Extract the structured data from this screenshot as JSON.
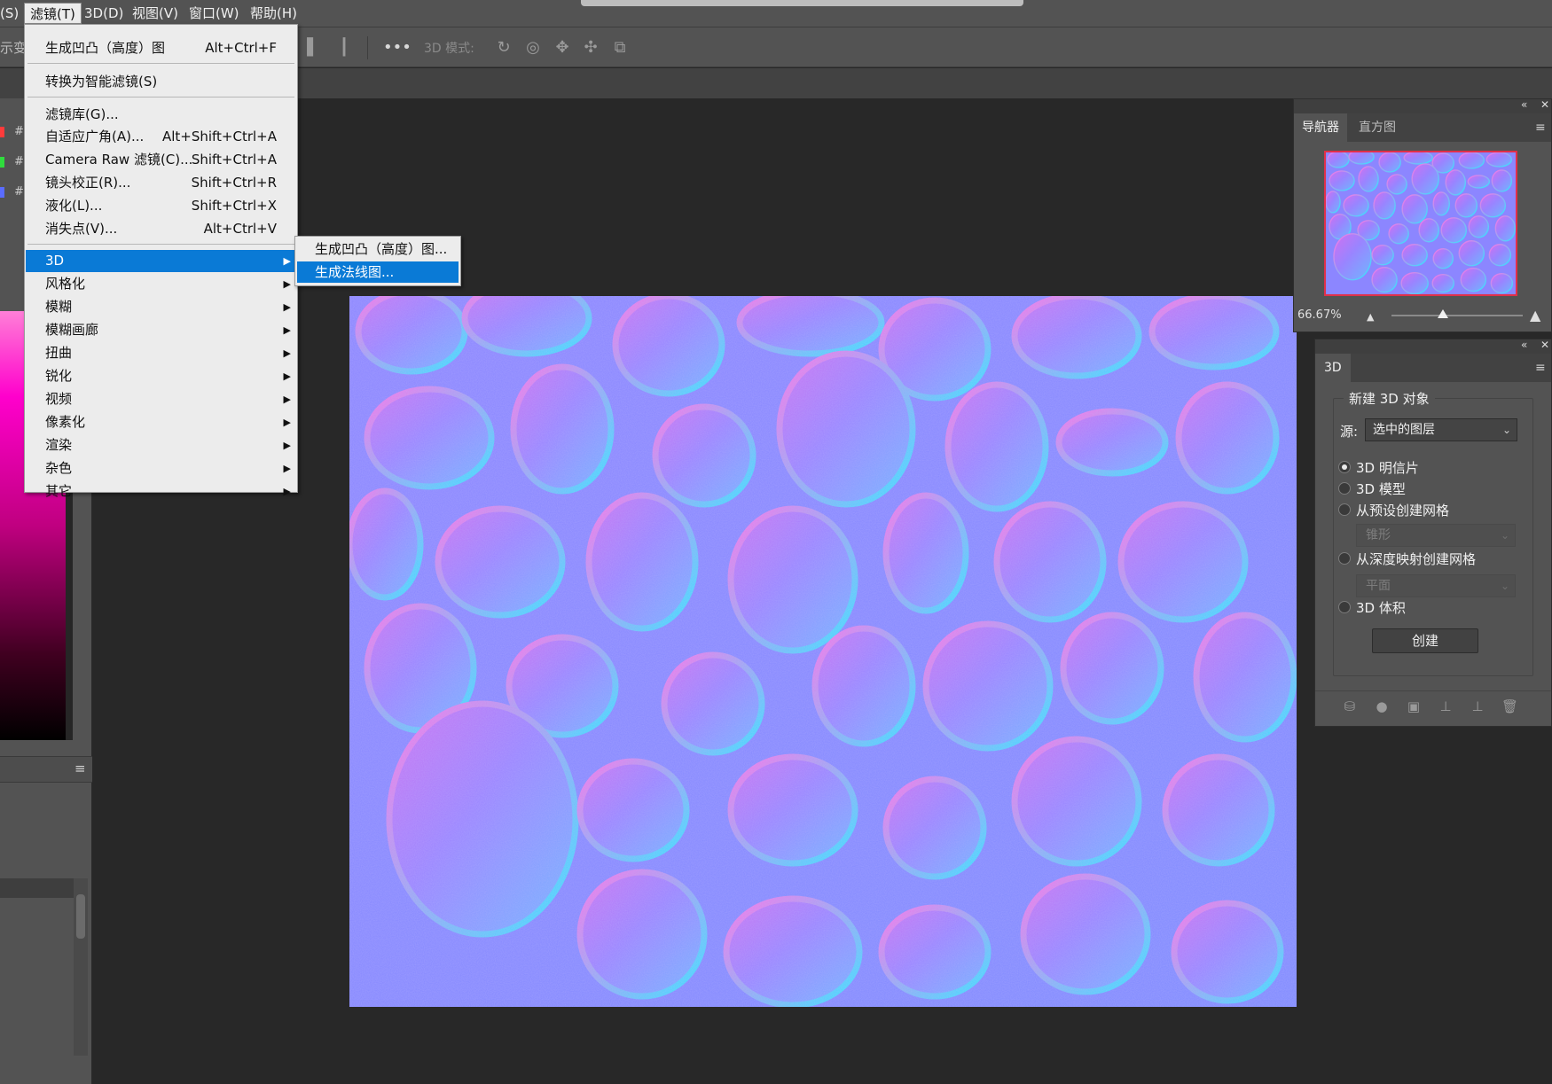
{
  "menubar": {
    "items": [
      "(S)",
      "滤镜(T)",
      "3D(D)",
      "视图(V)",
      "窗口(W)",
      "帮助(H)"
    ]
  },
  "options_bar": {
    "left_label": "示变",
    "three_d_mode_label": "3D 模式:"
  },
  "left_panel": {
    "swatch_hash": [
      "#",
      "#",
      "#"
    ],
    "swatch_colors": [
      "#ff3b3b",
      "#2fdc3d",
      "#5a6cff"
    ]
  },
  "filter_menu": {
    "items": [
      {
        "label": "生成凹凸（高度）图",
        "shortcut": "Alt+Ctrl+F"
      },
      {
        "label": "转换为智能滤镜(S)",
        "shortcut": ""
      },
      {
        "label": "滤镜库(G)...",
        "shortcut": ""
      },
      {
        "label": "自适应广角(A)...",
        "shortcut": "Alt+Shift+Ctrl+A"
      },
      {
        "label": "Camera Raw 滤镜(C)...",
        "shortcut": "Shift+Ctrl+A"
      },
      {
        "label": "镜头校正(R)...",
        "shortcut": "Shift+Ctrl+R"
      },
      {
        "label": "液化(L)...",
        "shortcut": "Shift+Ctrl+X"
      },
      {
        "label": "消失点(V)...",
        "shortcut": "Alt+Ctrl+V"
      },
      {
        "label": "3D",
        "shortcut": ""
      },
      {
        "label": "风格化",
        "shortcut": ""
      },
      {
        "label": "模糊",
        "shortcut": ""
      },
      {
        "label": "模糊画廊",
        "shortcut": ""
      },
      {
        "label": "扭曲",
        "shortcut": ""
      },
      {
        "label": "锐化",
        "shortcut": ""
      },
      {
        "label": "视频",
        "shortcut": ""
      },
      {
        "label": "像素化",
        "shortcut": ""
      },
      {
        "label": "渲染",
        "shortcut": ""
      },
      {
        "label": "杂色",
        "shortcut": ""
      },
      {
        "label": "其它",
        "shortcut": ""
      }
    ],
    "submenu_arrow": "▶"
  },
  "submenu_3d": {
    "items": [
      "生成凹凸（高度）图...",
      "生成法线图..."
    ]
  },
  "navigator": {
    "tabs": [
      "导航器",
      "直方图"
    ],
    "zoom": "66.67%"
  },
  "panel_3d": {
    "tab": "3D",
    "group_title": "新建 3D 对象",
    "source_label": "源:",
    "source_value": "选中的图层",
    "options": [
      "3D 明信片",
      "3D 模型",
      "从预设创建网格",
      "从深度映射创建网格",
      "3D 体积"
    ],
    "selected_option": "3D 明信片",
    "preset_mesh_value": "锥形",
    "depth_map_value": "平面",
    "create_button": "创建"
  },
  "colors": {
    "menu_highlight": "#0a7ad6",
    "ui_panel": "#535353",
    "canvas_bg": "#282828",
    "normal_map_base": "#8080ff"
  },
  "icons": {
    "panel_collapse": "«",
    "panel_close": "✕",
    "panel_menu": "≡",
    "dropdown": "⌄"
  }
}
